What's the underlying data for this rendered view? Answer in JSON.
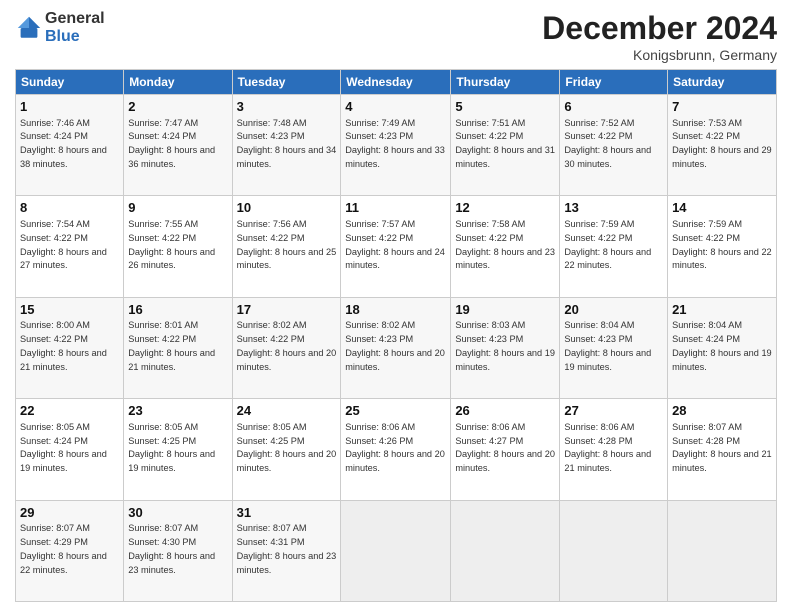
{
  "logo": {
    "general": "General",
    "blue": "Blue"
  },
  "header": {
    "month": "December 2024",
    "location": "Konigsbrunn, Germany"
  },
  "weekdays": [
    "Sunday",
    "Monday",
    "Tuesday",
    "Wednesday",
    "Thursday",
    "Friday",
    "Saturday"
  ],
  "weeks": [
    [
      {
        "day": "1",
        "sunrise": "7:46 AM",
        "sunset": "4:24 PM",
        "daylight": "8 hours and 38 minutes."
      },
      {
        "day": "2",
        "sunrise": "7:47 AM",
        "sunset": "4:24 PM",
        "daylight": "8 hours and 36 minutes."
      },
      {
        "day": "3",
        "sunrise": "7:48 AM",
        "sunset": "4:23 PM",
        "daylight": "8 hours and 34 minutes."
      },
      {
        "day": "4",
        "sunrise": "7:49 AM",
        "sunset": "4:23 PM",
        "daylight": "8 hours and 33 minutes."
      },
      {
        "day": "5",
        "sunrise": "7:51 AM",
        "sunset": "4:22 PM",
        "daylight": "8 hours and 31 minutes."
      },
      {
        "day": "6",
        "sunrise": "7:52 AM",
        "sunset": "4:22 PM",
        "daylight": "8 hours and 30 minutes."
      },
      {
        "day": "7",
        "sunrise": "7:53 AM",
        "sunset": "4:22 PM",
        "daylight": "8 hours and 29 minutes."
      }
    ],
    [
      {
        "day": "8",
        "sunrise": "7:54 AM",
        "sunset": "4:22 PM",
        "daylight": "8 hours and 27 minutes."
      },
      {
        "day": "9",
        "sunrise": "7:55 AM",
        "sunset": "4:22 PM",
        "daylight": "8 hours and 26 minutes."
      },
      {
        "day": "10",
        "sunrise": "7:56 AM",
        "sunset": "4:22 PM",
        "daylight": "8 hours and 25 minutes."
      },
      {
        "day": "11",
        "sunrise": "7:57 AM",
        "sunset": "4:22 PM",
        "daylight": "8 hours and 24 minutes."
      },
      {
        "day": "12",
        "sunrise": "7:58 AM",
        "sunset": "4:22 PM",
        "daylight": "8 hours and 23 minutes."
      },
      {
        "day": "13",
        "sunrise": "7:59 AM",
        "sunset": "4:22 PM",
        "daylight": "8 hours and 22 minutes."
      },
      {
        "day": "14",
        "sunrise": "7:59 AM",
        "sunset": "4:22 PM",
        "daylight": "8 hours and 22 minutes."
      }
    ],
    [
      {
        "day": "15",
        "sunrise": "8:00 AM",
        "sunset": "4:22 PM",
        "daylight": "8 hours and 21 minutes."
      },
      {
        "day": "16",
        "sunrise": "8:01 AM",
        "sunset": "4:22 PM",
        "daylight": "8 hours and 21 minutes."
      },
      {
        "day": "17",
        "sunrise": "8:02 AM",
        "sunset": "4:22 PM",
        "daylight": "8 hours and 20 minutes."
      },
      {
        "day": "18",
        "sunrise": "8:02 AM",
        "sunset": "4:23 PM",
        "daylight": "8 hours and 20 minutes."
      },
      {
        "day": "19",
        "sunrise": "8:03 AM",
        "sunset": "4:23 PM",
        "daylight": "8 hours and 19 minutes."
      },
      {
        "day": "20",
        "sunrise": "8:04 AM",
        "sunset": "4:23 PM",
        "daylight": "8 hours and 19 minutes."
      },
      {
        "day": "21",
        "sunrise": "8:04 AM",
        "sunset": "4:24 PM",
        "daylight": "8 hours and 19 minutes."
      }
    ],
    [
      {
        "day": "22",
        "sunrise": "8:05 AM",
        "sunset": "4:24 PM",
        "daylight": "8 hours and 19 minutes."
      },
      {
        "day": "23",
        "sunrise": "8:05 AM",
        "sunset": "4:25 PM",
        "daylight": "8 hours and 19 minutes."
      },
      {
        "day": "24",
        "sunrise": "8:05 AM",
        "sunset": "4:25 PM",
        "daylight": "8 hours and 20 minutes."
      },
      {
        "day": "25",
        "sunrise": "8:06 AM",
        "sunset": "4:26 PM",
        "daylight": "8 hours and 20 minutes."
      },
      {
        "day": "26",
        "sunrise": "8:06 AM",
        "sunset": "4:27 PM",
        "daylight": "8 hours and 20 minutes."
      },
      {
        "day": "27",
        "sunrise": "8:06 AM",
        "sunset": "4:28 PM",
        "daylight": "8 hours and 21 minutes."
      },
      {
        "day": "28",
        "sunrise": "8:07 AM",
        "sunset": "4:28 PM",
        "daylight": "8 hours and 21 minutes."
      }
    ],
    [
      {
        "day": "29",
        "sunrise": "8:07 AM",
        "sunset": "4:29 PM",
        "daylight": "8 hours and 22 minutes."
      },
      {
        "day": "30",
        "sunrise": "8:07 AM",
        "sunset": "4:30 PM",
        "daylight": "8 hours and 23 minutes."
      },
      {
        "day": "31",
        "sunrise": "8:07 AM",
        "sunset": "4:31 PM",
        "daylight": "8 hours and 23 minutes."
      },
      null,
      null,
      null,
      null
    ]
  ],
  "labels": {
    "sunrise": "Sunrise:",
    "sunset": "Sunset:",
    "daylight": "Daylight:"
  }
}
